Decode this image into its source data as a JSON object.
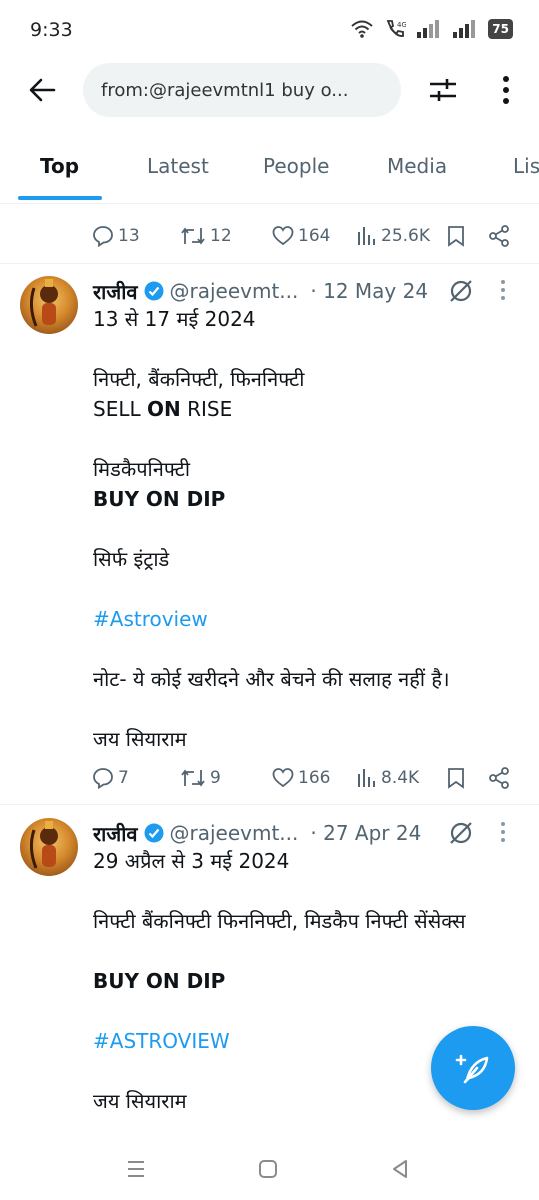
{
  "status_bar": {
    "time": "9:33",
    "battery": "75"
  },
  "search": {
    "query": "from:@rajeevmtnl1 buy o..."
  },
  "tabs": [
    {
      "label": "Top",
      "active": true
    },
    {
      "label": "Latest"
    },
    {
      "label": "People"
    },
    {
      "label": "Media"
    },
    {
      "label": "Lis"
    }
  ],
  "top_actions": {
    "replies": "13",
    "reposts": "12",
    "likes": "164",
    "views": "25.6K"
  },
  "tweets": [
    {
      "name": "राजीव",
      "handle": "@rajeevmt...",
      "date": "· 12 May 24",
      "lines": [
        "13 से 17 मई 2024",
        "",
        "निफ्टी, बैंकनिफ्टी, फिननिफ्टी",
        "SELL ON RISE",
        "",
        "मिडकैपनिफ्टी",
        "BUY ON DIP",
        "",
        "सिर्फ इंट्राडे",
        "",
        "#Astroview",
        "",
        "नोट- ये कोई खरीदने और बेचने की सलाह नहीं है।",
        "",
        "जय सियाराम"
      ],
      "sell_prefix": "SELL ",
      "sell_bold": "ON",
      "sell_suffix": " RISE",
      "replies": "7",
      "reposts": "9",
      "likes": "166",
      "views": "8.4K"
    },
    {
      "name": "राजीव",
      "handle": "@rajeevmt...",
      "date": "· 27 Apr 24",
      "lines": [
        "29 अप्रैल से 3 मई 2024",
        "",
        "निफ्टी बैंकनिफ्टी फिननिफ्टी, मिडकैप निफ्टी सेंसेक्स",
        "",
        "BUY ON DIP",
        "",
        "#ASTROVIEW",
        "",
        "जय सियाराम"
      ]
    }
  ],
  "colors": {
    "accent": "#1d9bf0",
    "muted": "#536471",
    "text": "#0f1419"
  }
}
